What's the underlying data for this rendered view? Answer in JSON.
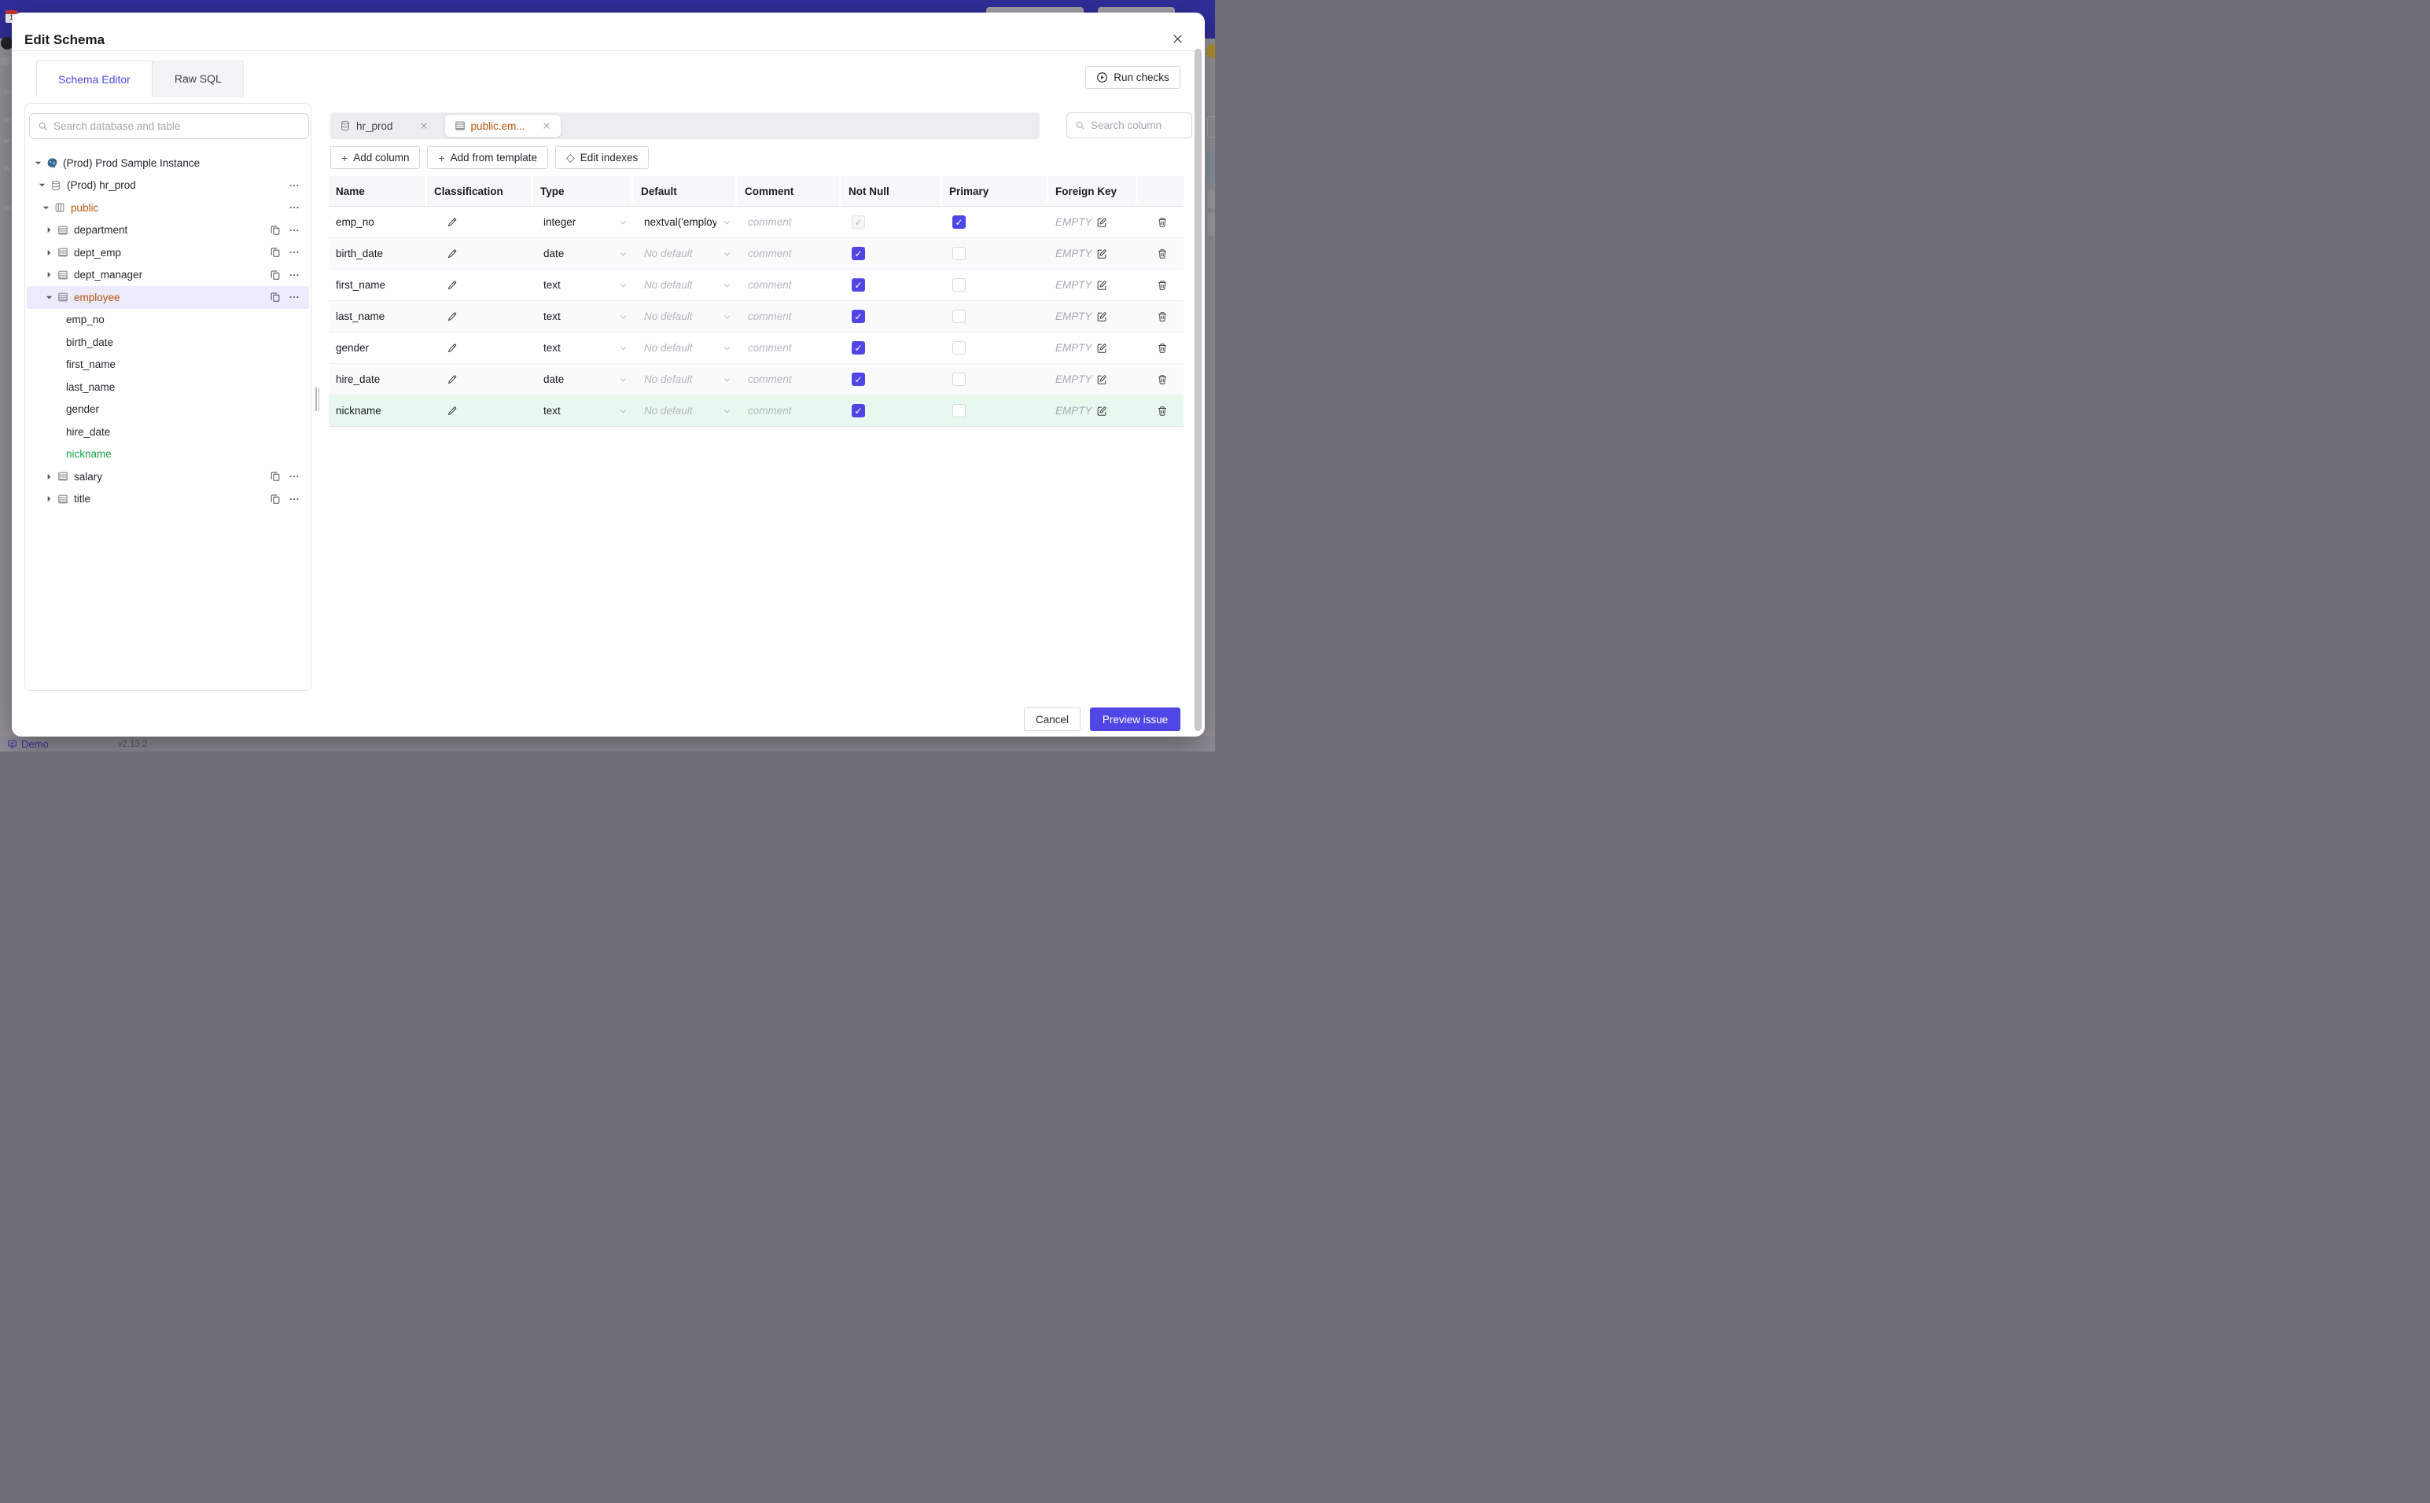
{
  "backdrop": {
    "statusbar": {
      "demo_label": "Demo",
      "version": "v2.13.2"
    },
    "icons": {
      "calendar": "calendar-icon",
      "presentation": "presentation-board-icon"
    }
  },
  "modal": {
    "title": "Edit Schema",
    "close_icon": "close-x",
    "tabs": [
      {
        "label": "Schema Editor",
        "active": true
      },
      {
        "label": "Raw SQL",
        "active": false
      }
    ],
    "run_checks_label": "Run checks"
  },
  "sidebar": {
    "search_placeholder": "Search database and table",
    "tree": [
      {
        "label": "(Prod) Prod Sample Instance",
        "level": 0,
        "caret": "down",
        "icon": "postgres",
        "color": null,
        "selected": false,
        "actions": []
      },
      {
        "label": "(Prod) hr_prod",
        "level": 1,
        "caret": "down",
        "icon": "database",
        "color": null,
        "selected": false,
        "actions": [
          "more"
        ]
      },
      {
        "label": "public",
        "level": 2,
        "caret": "down",
        "icon": "schema",
        "color": "amber",
        "selected": false,
        "actions": [
          "more"
        ]
      },
      {
        "label": "department",
        "level": 3,
        "caret": "right",
        "icon": "table",
        "color": null,
        "selected": false,
        "actions": [
          "copy",
          "more"
        ]
      },
      {
        "label": "dept_emp",
        "level": 3,
        "caret": "right",
        "icon": "table",
        "color": null,
        "selected": false,
        "actions": [
          "copy",
          "more"
        ]
      },
      {
        "label": "dept_manager",
        "level": 3,
        "caret": "right",
        "icon": "table",
        "color": null,
        "selected": false,
        "actions": [
          "copy",
          "more"
        ]
      },
      {
        "label": "employee",
        "level": 3,
        "caret": "down",
        "icon": "table",
        "color": "amber",
        "selected": true,
        "actions": [
          "copy",
          "more"
        ]
      },
      {
        "label": "emp_no",
        "level": 4,
        "caret": null,
        "icon": null,
        "color": null,
        "selected": false,
        "actions": []
      },
      {
        "label": "birth_date",
        "level": 4,
        "caret": null,
        "icon": null,
        "color": null,
        "selected": false,
        "actions": []
      },
      {
        "label": "first_name",
        "level": 4,
        "caret": null,
        "icon": null,
        "color": null,
        "selected": false,
        "actions": []
      },
      {
        "label": "last_name",
        "level": 4,
        "caret": null,
        "icon": null,
        "color": null,
        "selected": false,
        "actions": []
      },
      {
        "label": "gender",
        "level": 4,
        "caret": null,
        "icon": null,
        "color": null,
        "selected": false,
        "actions": []
      },
      {
        "label": "hire_date",
        "level": 4,
        "caret": null,
        "icon": null,
        "color": null,
        "selected": false,
        "actions": []
      },
      {
        "label": "nickname",
        "level": 4,
        "caret": null,
        "icon": null,
        "color": "green",
        "selected": false,
        "actions": []
      },
      {
        "label": "salary",
        "level": 3,
        "caret": "right",
        "icon": "table",
        "color": null,
        "selected": false,
        "actions": [
          "copy",
          "more"
        ]
      },
      {
        "label": "title",
        "level": 3,
        "caret": "right",
        "icon": "table",
        "color": null,
        "selected": false,
        "actions": [
          "copy",
          "more"
        ]
      }
    ]
  },
  "editor": {
    "open_tabs": [
      {
        "label": "hr_prod",
        "icon": "database",
        "active": false
      },
      {
        "label": "public.em...",
        "icon": "table",
        "active": true
      }
    ],
    "search_placeholder": "Search column",
    "toolbar": [
      {
        "label": "Add column",
        "prefix": "+"
      },
      {
        "label": "Add from template",
        "prefix": "+"
      },
      {
        "label": "Edit indexes",
        "prefix": "◇"
      }
    ],
    "table": {
      "headers": [
        "Name",
        "Classification",
        "Type",
        "Default",
        "Comment",
        "Not Null",
        "Primary",
        "Foreign Key",
        ""
      ],
      "comment_placeholder": "comment",
      "empty_label": "EMPTY",
      "rows": [
        {
          "name": "emp_no",
          "type": "integer",
          "default": "nextval('employ",
          "default_kind": "value",
          "not_null": "discheck",
          "primary": "checked",
          "highlight": false
        },
        {
          "name": "birth_date",
          "type": "date",
          "default": "No default",
          "default_kind": "placeholder",
          "not_null": "checked",
          "primary": "unchecked",
          "highlight": false
        },
        {
          "name": "first_name",
          "type": "text",
          "default": "No default",
          "default_kind": "placeholder",
          "not_null": "checked",
          "primary": "unchecked",
          "highlight": false
        },
        {
          "name": "last_name",
          "type": "text",
          "default": "No default",
          "default_kind": "placeholder",
          "not_null": "checked",
          "primary": "unchecked",
          "highlight": false
        },
        {
          "name": "gender",
          "type": "text",
          "default": "No default",
          "default_kind": "placeholder",
          "not_null": "checked",
          "primary": "unchecked",
          "highlight": false
        },
        {
          "name": "hire_date",
          "type": "date",
          "default": "No default",
          "default_kind": "placeholder",
          "not_null": "checked",
          "primary": "unchecked",
          "highlight": false
        },
        {
          "name": "nickname",
          "type": "text",
          "default": "No default",
          "default_kind": "placeholder",
          "not_null": "checked",
          "primary": "unchecked",
          "highlight": true
        }
      ]
    }
  },
  "footer": {
    "cancel_label": "Cancel",
    "submit_label": "Preview issue"
  },
  "colors": {
    "accent": "#4f46e5",
    "amber": "#b45309",
    "green": "#16a34a",
    "topbar": "#312e9b",
    "new_row_bg": "#e8f8ef",
    "selected_bg": "#eceafc"
  }
}
